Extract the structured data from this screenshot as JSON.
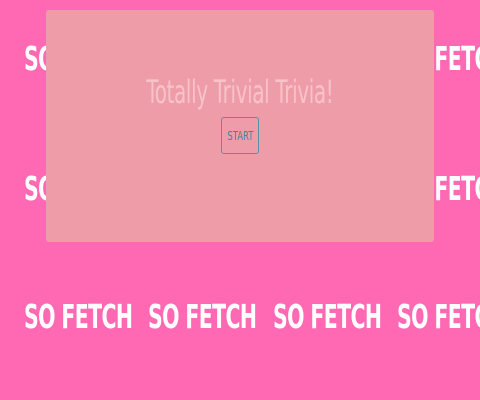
{
  "background": {
    "color": "#ff69b4",
    "tile_text": "SO FETCH"
  },
  "panel": {
    "color": "#ee9ca8",
    "title": "Totally Trivial Trivia!",
    "start_label": "START"
  }
}
